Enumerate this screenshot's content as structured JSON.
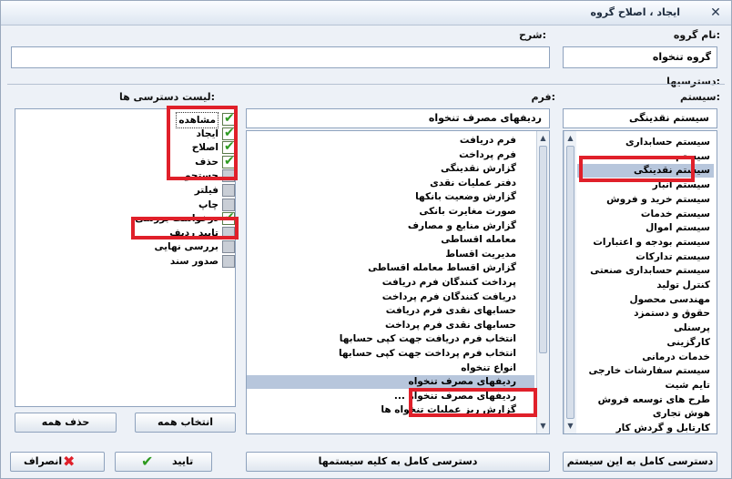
{
  "window": {
    "title": "ایجاد ، اصلاح گروه"
  },
  "fields": {
    "group_name_label": "نام گروه:",
    "group_name_value": "گروه تنخواه",
    "description_label": "شرح:",
    "description_value": ""
  },
  "section": {
    "access_label": "دسترسیها:"
  },
  "systems": {
    "label": "سیستم:",
    "selected": "سیستم نقدینگی",
    "items": [
      "سیستم حسابداری",
      "سیستم ...",
      "سیستم نقدینگی",
      "سیستم انبار",
      "سیستم خرید و فروش",
      "سیستم خدمات",
      "سیستم اموال",
      "سیستم بودجه و اعتبارات",
      "سیستم تدارکات",
      "سیستم حسابداری صنعتی",
      "کنترل تولید",
      "مهندسی محصول",
      "حقوق و دستمزد",
      "پرسنلی",
      "کارگزینی",
      "خدمات درمانی",
      "سیستم سفارشات خارجی",
      "تایم شیت",
      "طرح های توسعه فروش",
      "هوش تجاری",
      "کارتابل و گردش کار"
    ]
  },
  "forms": {
    "label": "فرم:",
    "selected": "ردیفهای مصرف تنخواه",
    "items": [
      "فرم دریافت",
      "فرم پرداخت",
      "گزارش نقدینگی",
      "دفتر عملیات نقدی",
      "گزارش وضعیت بانکها",
      "صورت مغایرت بانکی",
      "گزارش منابع و مصارف",
      "معامله اقساطی",
      "مدیریت اقساط",
      "گزارش اقساط معامله اقساطی",
      "پرداخت کنندگان فرم دریافت",
      "دریافت کنندگان فرم پرداخت",
      "حسابهای نقدی فرم دریافت",
      "حسابهای نقدی فرم پرداخت",
      "انتخاب فرم دریافت جهت کپی حسابها",
      "انتخاب فرم پرداخت جهت کپی حسابها",
      "انواع تنخواه",
      "ردیفهای مصرف تنخواه",
      "ردیفهای مصرف تنخواه ...",
      "گزارش ریز عملیات تنخواه ها"
    ]
  },
  "permissions": {
    "label": "لیست دسترسی ها:",
    "items": [
      {
        "label": "مشاهده",
        "checked": true
      },
      {
        "label": "ایجاد",
        "checked": true
      },
      {
        "label": "اصلاح",
        "checked": true
      },
      {
        "label": "حذف",
        "checked": true
      },
      {
        "label": "جستجو",
        "checked": false
      },
      {
        "label": "فیلتر",
        "checked": false
      },
      {
        "label": "چاپ",
        "checked": false
      },
      {
        "label": "درخواست بررسی",
        "checked": true
      },
      {
        "label": "تایید ردیف",
        "checked": false
      },
      {
        "label": "بررسی نهایی",
        "checked": false
      },
      {
        "label": "صدور سند",
        "checked": false
      }
    ]
  },
  "buttons": {
    "select_all": "انتخاب همه",
    "remove_all": "حذف همه",
    "full_access_all_systems": "دسترسی کامل به کلیه سیستمها",
    "full_access_this_system": "دسترسی کامل به این سیستم",
    "confirm": "تایید",
    "cancel": "انصراف"
  },
  "colors": {
    "highlight": "#e0202a",
    "check": "#2e9b22",
    "selection": "#b7c6dc"
  }
}
